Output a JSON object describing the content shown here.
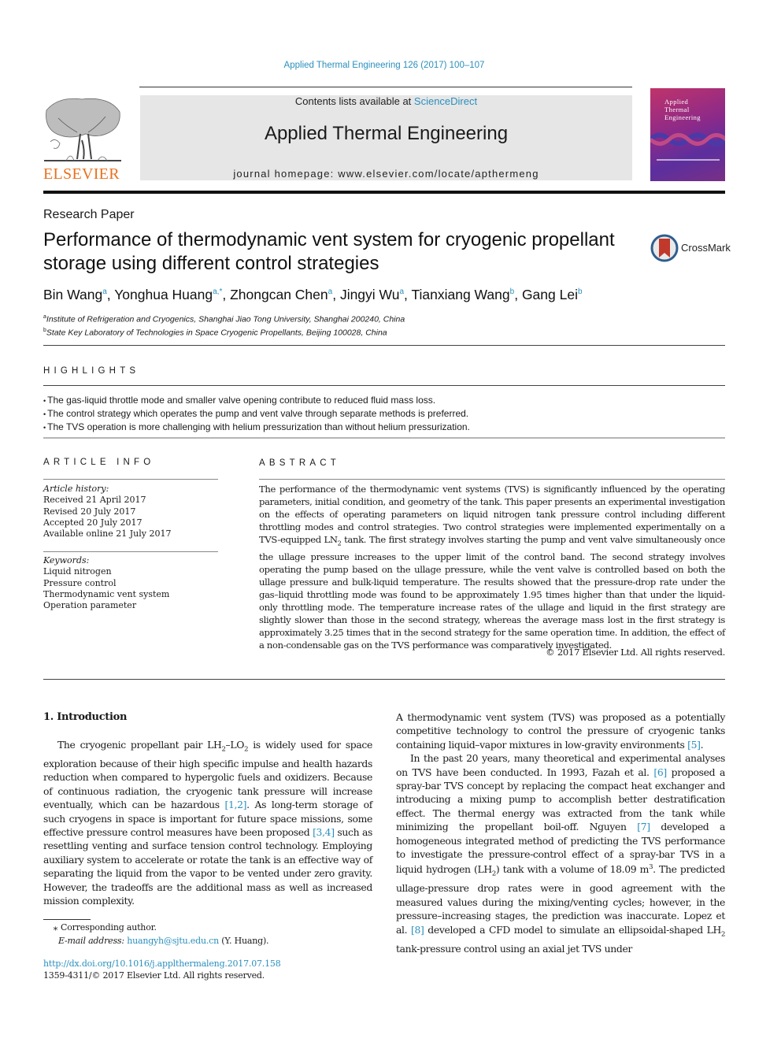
{
  "header": {
    "journal_reference": "Applied Thermal Engineering 126 (2017) 100–107",
    "contents_prefix": "Contents lists available at ",
    "contents_link": "ScienceDirect",
    "journal_title": "Applied Thermal Engineering",
    "homepage_prefix": "journal homepage: ",
    "homepage_url": "www.elsevier.com/locate/apthermeng",
    "publisher_logo_text": "ELSEVIER",
    "cover_title_lines": [
      "Applied",
      "Thermal",
      "Engineering"
    ],
    "brand_colors": {
      "link": "#2a8fbd",
      "elsevier_orange": "#e9711c",
      "masthead_bg": "#e6e6e6"
    }
  },
  "article": {
    "type": "Research Paper",
    "title": "Performance of thermodynamic vent system for cryogenic propellant storage using different control strategies",
    "crossmark_label": "CrossMark",
    "authors": [
      {
        "name": "Bin Wang",
        "aff": "a"
      },
      {
        "name": "Yonghua Huang",
        "aff": "a,*"
      },
      {
        "name": "Zhongcan Chen",
        "aff": "a"
      },
      {
        "name": "Jingyi Wu",
        "aff": "a"
      },
      {
        "name": "Tianxiang Wang",
        "aff": "b"
      },
      {
        "name": "Gang Lei",
        "aff": "b"
      }
    ],
    "affiliations": [
      {
        "mark": "a",
        "text": "Institute of Refrigeration and Cryogenics, Shanghai Jiao Tong University, Shanghai 200240, China"
      },
      {
        "mark": "b",
        "text": "State Key Laboratory of Technologies in Space Cryogenic Propellants, Beijing 100028, China"
      }
    ]
  },
  "highlights": {
    "heading": "HIGHLIGHTS",
    "items": [
      "The gas-liquid throttle mode and smaller valve opening contribute to reduced fluid mass loss.",
      "The control strategy which operates the pump and vent valve through separate methods is preferred.",
      "The TVS operation is more challenging with helium pressurization than without helium pressurization."
    ]
  },
  "article_info": {
    "heading": "ARTICLE INFO",
    "history_label": "Article history:",
    "history": [
      "Received 21 April 2017",
      "Revised 20 July 2017",
      "Accepted 20 July 2017",
      "Available online 21 July 2017"
    ],
    "keywords_label": "Keywords:",
    "keywords": [
      "Liquid nitrogen",
      "Pressure control",
      "Thermodynamic vent system",
      "Operation parameter"
    ]
  },
  "abstract": {
    "heading": "ABSTRACT",
    "part1": "The performance of the thermodynamic vent systems (TVS) is significantly influenced by the operating parameters, initial condition, and geometry of the tank. This paper presents an experimental investigation on the effects of operating parameters on liquid nitrogen tank pressure control including different throttling modes and control strategies. Two control strategies were implemented experimentally on a TVS-equipped LN",
    "sub1": "2",
    "part2": " tank. The first strategy involves starting the pump and vent valve simultaneously once the ullage pressure increases to the upper limit of the control band. The second strategy involves operating the pump based on the ullage pressure, while the vent valve is controlled based on both the ullage pressure and bulk-liquid temperature. The results showed that the pressure-drop rate under the gas–liquid throttling mode was found to be approximately 1.95 times higher than that under the liquid-only throttling mode. The temperature increase rates of the ullage and liquid in the first strategy are slightly slower than those in the second strategy, whereas the average mass lost in the first strategy is approximately 3.25 times that in the second strategy for the same operation time. In addition, the effect of a non-condensable gas on the TVS performance was comparatively investigated.",
    "copyright": "© 2017 Elsevier Ltd. All rights reserved."
  },
  "introduction": {
    "heading": "1. Introduction",
    "left": {
      "p1_a": "The cryogenic propellant pair LH",
      "p1_sub1": "2",
      "p1_b": "–LO",
      "p1_sub2": "2",
      "p1_c": " is widely used for space exploration because of their high specific impulse and health hazards reduction when compared to hypergolic fuels and oxidizers. Because of continuous radiation, the cryogenic tank pressure will increase eventually, which can be hazardous ",
      "ref1": "[1,2]",
      "p1_d": ". As long-term storage of such cryogens in space is important for future space missions, some effective pressure control measures have been proposed ",
      "ref2": "[3,4]",
      "p1_e": " such as resettling venting and surface tension control technology. Employing auxiliary system to accelerate or rotate the tank is an effective way of separating the liquid from the vapor to be vented under zero gravity. However, the tradeoffs are the additional mass as well as increased mission complexity."
    },
    "right": {
      "p1_a": "A thermodynamic vent system (TVS) was proposed as a potentially competitive technology to control the pressure of cryogenic tanks containing liquid–vapor mixtures in low-gravity environments ",
      "ref5": "[5]",
      "p1_b": ".",
      "p2_a": "In the past 20 years, many theoretical and experimental analyses on TVS have been conducted. In 1993, Fazah et al. ",
      "ref6": "[6]",
      "p2_b": " proposed a spray-bar TVS concept by replacing the compact heat exchanger and introducing a mixing pump to accomplish better destratification effect. The thermal energy was extracted from the tank while minimizing the propellant boil-off. Nguyen ",
      "ref7": "[7]",
      "p2_c": " developed a homogeneous integrated method of predicting the TVS performance to investigate the pressure-control effect of a spray-bar TVS in a liquid hydrogen (LH",
      "p2_sub1": "2",
      "p2_d": ") tank with a volume of 18.09 m",
      "p2_sup1": "3",
      "p2_e": ". The predicted ullage-pressure drop rates were in good agreement with the measured values during the mixing/venting cycles; however, in the pressure–increasing stages, the prediction was inaccurate. Lopez et al. ",
      "ref8": "[8]",
      "p2_f": " developed a CFD model to simulate an ellipsoidal-shaped LH",
      "p2_sub2": "2",
      "p2_g": " tank-pressure control using an axial jet TVS under"
    }
  },
  "footnotes": {
    "star": "⁎",
    "corresponding": "Corresponding author.",
    "email_label": "E-mail address: ",
    "email": "huangyh@sjtu.edu.cn",
    "email_suffix": " (Y. Huang).",
    "doi": "http://dx.doi.org/10.1016/j.applthermaleng.2017.07.158",
    "issn_line": "1359-4311/© 2017 Elsevier Ltd. All rights reserved."
  }
}
